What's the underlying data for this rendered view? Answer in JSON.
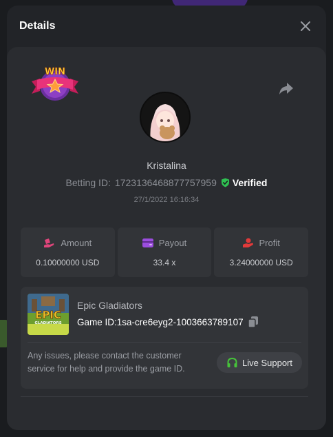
{
  "modal": {
    "title": "Details",
    "close_icon": "close-icon"
  },
  "player": {
    "badge_text": "WIN",
    "name": "Kristalina",
    "betting_id_label": "Betting ID:",
    "betting_id": "1723136468877757959",
    "verified_label": "Verified",
    "timestamp": "27/1/2022 16:16:34"
  },
  "stats": [
    {
      "label": "Amount",
      "value": "0.10000000 USD",
      "icon": "bet-amount-icon",
      "icon_color": "#e0457b"
    },
    {
      "label": "Payout",
      "value": "33.4 x",
      "icon": "wallet-icon",
      "icon_color": "#9b4dde"
    },
    {
      "label": "Profit",
      "value": "3.24000000 USD",
      "icon": "profit-hand-icon",
      "icon_color": "#e23a3a"
    }
  ],
  "game": {
    "name": "Epic Gladiators",
    "game_id_label": "Game ID:",
    "game_id": "1sa-cre6eyg2-1003663789107",
    "thumb_title": "EPIC",
    "thumb_subtitle": "GLADIATORS",
    "support_text": "Any issues, please contact the customer service for help and provide the game ID.",
    "support_button": "Live Support"
  },
  "colors": {
    "verified_green": "#2fc152",
    "support_green": "#46c33a"
  }
}
